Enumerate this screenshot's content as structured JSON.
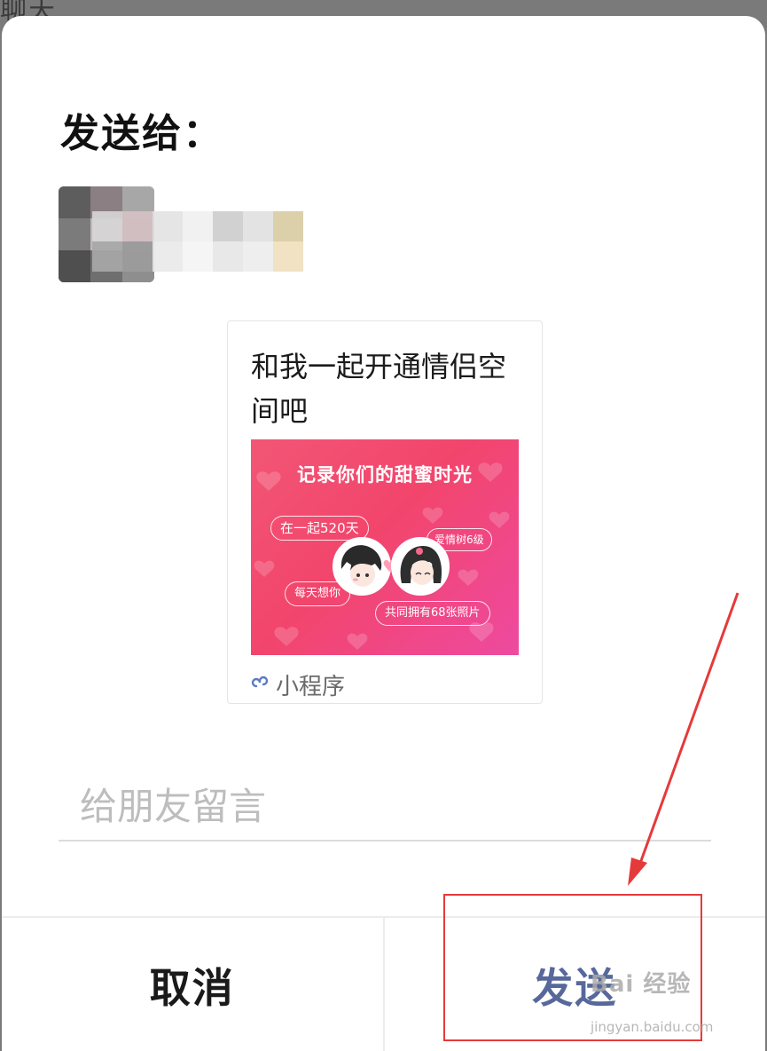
{
  "background": {
    "title": "聊天"
  },
  "dialog": {
    "heading": "发送给：",
    "recipient": {
      "name_obscured": true
    },
    "share_card": {
      "title": "和我一起开通情侣空间吧",
      "banner": {
        "headline": "记录你们的甜蜜时光",
        "pills": [
          "在一起520天",
          "爱情树6级",
          "每天想你",
          "共同拥有68张照片"
        ],
        "colors": {
          "from": "#f25675",
          "to": "#ee4aa0"
        }
      },
      "footer": {
        "icon": "mini-program-icon",
        "label": "小程序"
      }
    },
    "message": {
      "placeholder": "给朋友留言",
      "value": ""
    },
    "actions": {
      "cancel": "取消",
      "send": "发送"
    }
  },
  "annotation": {
    "color": "#e53a3a",
    "target": "send-button"
  },
  "watermark": {
    "brand": "Bai 经验",
    "url": "jingyan.baidu.com"
  },
  "colors": {
    "send_text": "#57689b",
    "cancel_text": "#1a1a1a",
    "divider": "#ececec"
  }
}
